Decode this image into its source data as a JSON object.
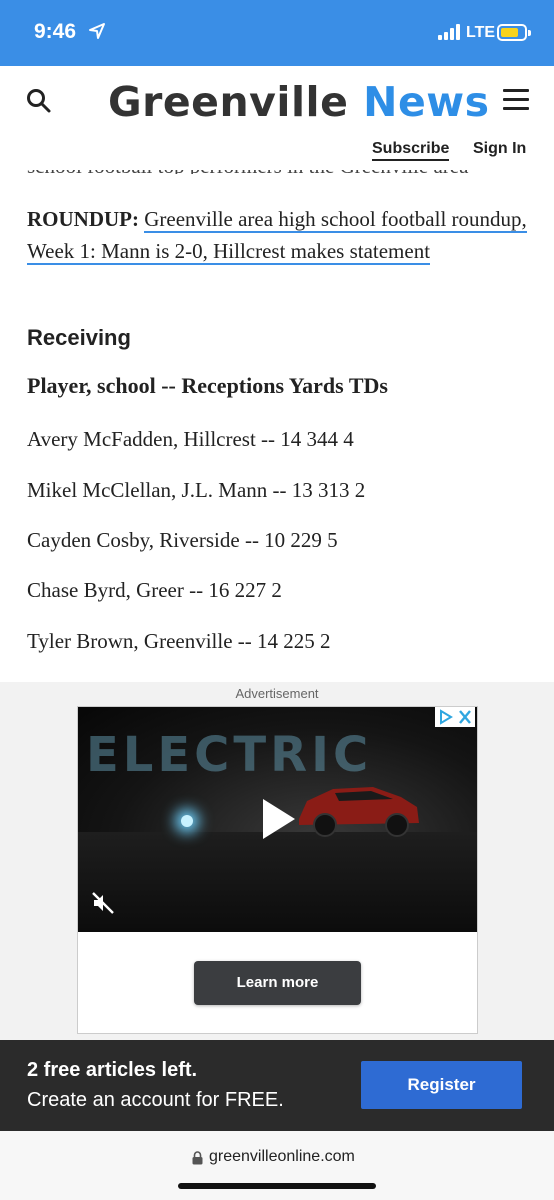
{
  "status_bar": {
    "time": "9:46",
    "network": "LTE"
  },
  "header": {
    "logo_word1": "Greenville",
    "logo_word2": "News",
    "subscribe_label": "Subscribe",
    "signin_label": "Sign In"
  },
  "article": {
    "cutoff_line": "school football top performers in the Greenville area",
    "roundup_label": "ROUNDUP:",
    "roundup_link": "Greenville area high school football roundup, Week 1: Mann is 2-0, Hillcrest makes statement",
    "section_heading": "Receiving",
    "columns_header": "Player, school -- Receptions Yards TDs",
    "rows": [
      "Avery McFadden, Hillcrest -- 14 344 4",
      "Mikel McClellan, J.L. Mann -- 13 313 2",
      "Cayden Cosby, Riverside -- 10 229 5",
      "Chase Byrd, Greer -- 16 227 2",
      "Tyler Brown, Greenville -- 14 225 2"
    ]
  },
  "ad": {
    "label": "Advertisement",
    "cta": "Learn more",
    "video_sign_text": "ELECTRIC"
  },
  "banner": {
    "line1": "2 free articles left.",
    "line2": "Create an account for FREE.",
    "register_label": "Register"
  },
  "url_bar": {
    "url": "greenvilleonline.com"
  },
  "colors": {
    "status_bar_bg": "#3a8ee6",
    "brand_blue": "#2e8ee6",
    "link_underline": "#3a8ee6",
    "register_button": "#2e6bd3",
    "banner_bg": "#2b2b2b"
  }
}
